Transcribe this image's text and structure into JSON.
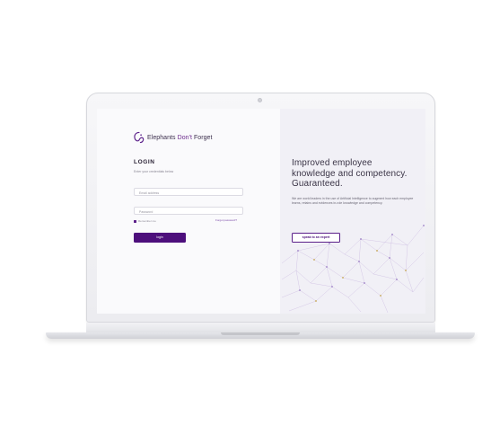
{
  "brand": {
    "name_pre": "Elephants ",
    "name_accent": "Don't",
    "name_post": " Forget",
    "accent_color": "#4d0f7c"
  },
  "login": {
    "title": "LOGIN",
    "subtitle": "Enter your credentials below",
    "email_placeholder": "Email address",
    "password_placeholder": "Password",
    "remember_label": "Remember me",
    "forgot_label": "Forgot password?",
    "button_label": "login"
  },
  "promo": {
    "headline_line1": "Improved employee",
    "headline_line2": "knowledge and competency.",
    "headline_line3": "Guaranteed.",
    "body": "We are world leaders in the use of Artificial Intelligence to augment how each employee learns, retains and evidences in-role knowledge and competency.",
    "button_label": "speak to an expert"
  },
  "icons": {
    "logo": "elephant-logo-icon",
    "decoration": "network-graph-icon"
  }
}
